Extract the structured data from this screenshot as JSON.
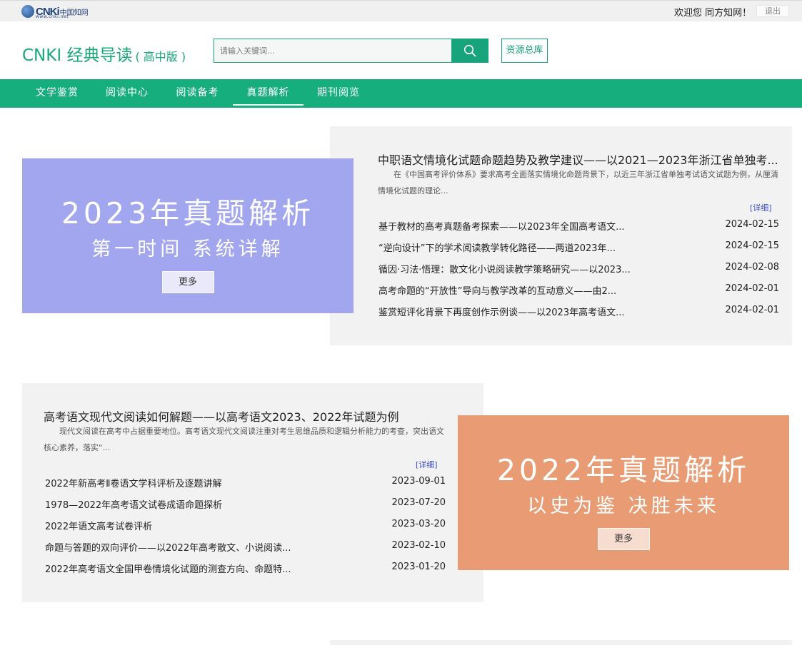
{
  "topbar": {
    "logo_text": "CNKi",
    "logo_cn": "中国知网",
    "logo_url": "www.cnki.net",
    "welcome": "欢迎您 同方知网！",
    "logout": "退出"
  },
  "header": {
    "brand": "CNKI 经典导读",
    "brand_sub": "( 高中版 )",
    "search_placeholder": "请输入关键词...",
    "resource_button": "资源总库"
  },
  "nav": {
    "items": [
      "文学鉴赏",
      "阅读中心",
      "阅读备考",
      "真题解析",
      "期刊阅览"
    ],
    "active_index": 3
  },
  "section_2023": {
    "banner_title": "2023年真题解析",
    "banner_sub": "第一时间 系统详解",
    "more": "更多",
    "featured_title": "中职语文情境化试题命题趋势及教学建议——以2021—2023年浙江省单独考...",
    "featured_desc": "在《中国高考评价体系》要求高考全面落实情境化命题背景下，以近三年浙江省单独考试语文试题为例，从厘清情境化试题的理论...",
    "detail": "[详细]",
    "items": [
      {
        "title": "基于教材的高考真题备考探索——以2023年全国高考语文...",
        "date": "2024-02-15"
      },
      {
        "title": "“逆向设计”下的学术阅读教学转化路径——两道2023年...",
        "date": "2024-02-15"
      },
      {
        "title": "循因·习法·悟理：散文化小说阅读教学策略研究——以2023...",
        "date": "2024-02-08"
      },
      {
        "title": "高考命题的“开放性”导向与教学改革的互动意义——由2...",
        "date": "2024-02-01"
      },
      {
        "title": "鉴赏短评化背景下再度创作示例谈——以2023年高考语文...",
        "date": "2024-02-01"
      }
    ]
  },
  "section_2022": {
    "banner_title": "2022年真题解析",
    "banner_sub": "以史为鉴 决胜未来",
    "more": "更多",
    "featured_title": "高考语文现代文阅读如何解题——以高考语文2023、2022年试题为例",
    "featured_desc": "现代文阅读在高考中占据重要地位。高考语文现代文阅读注重对考生思维品质和逻辑分析能力的考查，突出语文核心素养，落实“...",
    "detail": "[详细]",
    "items": [
      {
        "title": "2022年新高考Ⅱ卷语文学科评析及逐题讲解",
        "date": "2023-09-01"
      },
      {
        "title": "1978—2022年高考语文试卷成语命题探析",
        "date": "2023-07-20"
      },
      {
        "title": "2022年语文高考试卷评析",
        "date": "2023-03-20"
      },
      {
        "title": "命题与答题的双向评价——以2022年高考散文、小说阅读...",
        "date": "2023-02-10"
      },
      {
        "title": "2022年高考语文全国甲卷情境化试题的测查方向、命题特...",
        "date": "2023-01-20"
      }
    ]
  },
  "colors": {
    "primary": "#17ae7e",
    "banner_2023": "#a2a6ee",
    "banner_2022": "#e99c73",
    "panel_bg": "#f2f2f2"
  }
}
